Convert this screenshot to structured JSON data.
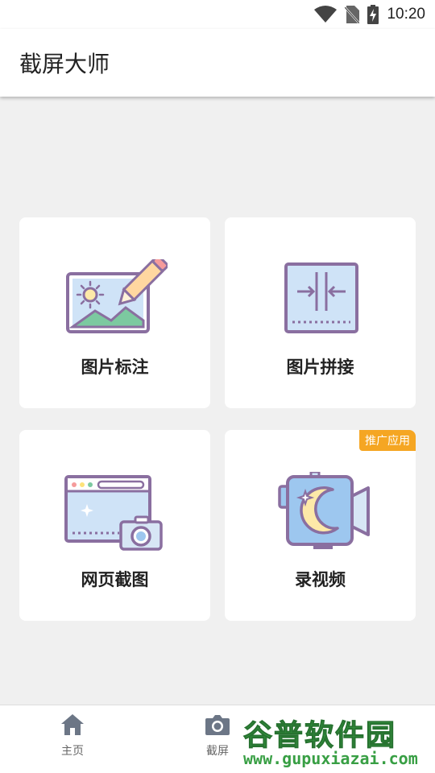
{
  "status_bar": {
    "time": "10:20",
    "icons": [
      "wifi-icon",
      "no-sim-icon",
      "battery-charging-icon"
    ]
  },
  "app_bar": {
    "title": "截屏大师"
  },
  "features": [
    {
      "label": "图片标注",
      "icon": "image-annotate-icon"
    },
    {
      "label": "图片拼接",
      "icon": "image-stitch-icon"
    },
    {
      "label": "网页截图",
      "icon": "webpage-screenshot-icon"
    },
    {
      "label": "录视频",
      "icon": "record-video-icon",
      "badge": "推广应用"
    }
  ],
  "bottom_nav": {
    "items": [
      {
        "label": "主页",
        "icon": "home-icon"
      },
      {
        "label": "截屏",
        "icon": "camera-icon"
      }
    ]
  },
  "watermark": {
    "title": "谷普软件园",
    "url": "www.gupuxiazai.com"
  },
  "colors": {
    "accent_badge": "#f5a623",
    "background": "#f0f0f0",
    "card": "#ffffff"
  }
}
